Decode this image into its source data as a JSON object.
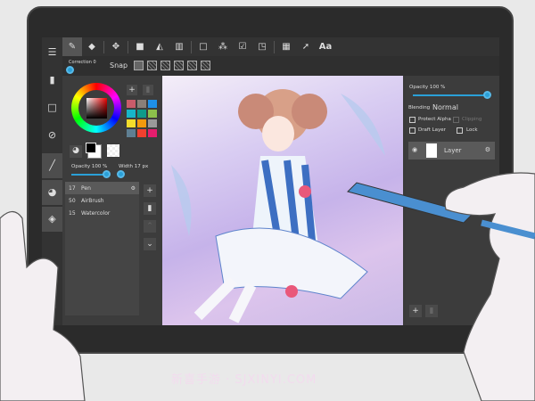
{
  "toolbar": {
    "text_tool": "Aa",
    "icons": [
      "pen-icon",
      "eraser-icon",
      "move-icon",
      "fill-rect-icon",
      "bucket-icon",
      "gradient-icon",
      "select-rect-icon",
      "magic-wand-icon",
      "select-pen-icon",
      "select-eraser-icon",
      "divide-icon",
      "operation-icon",
      "text-icon"
    ]
  },
  "subtoolbar": {
    "correction": "Correction 0",
    "snap": "Snap"
  },
  "color": {
    "palette": [
      "#c95b6a",
      "#8a7f78",
      "#1e90e8",
      "#17b6c9",
      "#0e9b8a",
      "#8cc04b",
      "#f3dd2b",
      "#f39a0d",
      "#9a9a9a",
      "#5f7f92",
      "#f1402f",
      "#e51d6d"
    ],
    "primary": "#000000"
  },
  "brush": {
    "opacity_label": "Opacity 100 %",
    "width_label": "Width 17 px",
    "opacity": 1.0,
    "items": [
      {
        "size": "17",
        "name": "Pen",
        "selected": true
      },
      {
        "size": "50",
        "name": "AirBrush"
      },
      {
        "size": "15",
        "name": "Watercolor"
      }
    ]
  },
  "layers": {
    "opacity_label": "Opacity 100 %",
    "opacity": 1.0,
    "blending_label": "Blending",
    "blending_value": "Normal",
    "protect_alpha": "Protect Alpha",
    "clipping": "Clipping",
    "draft_layer": "Draft Layer",
    "lock": "Lock",
    "layer_name": "Layer"
  },
  "watermark": "新喜手游 · SJXINYI.COM"
}
